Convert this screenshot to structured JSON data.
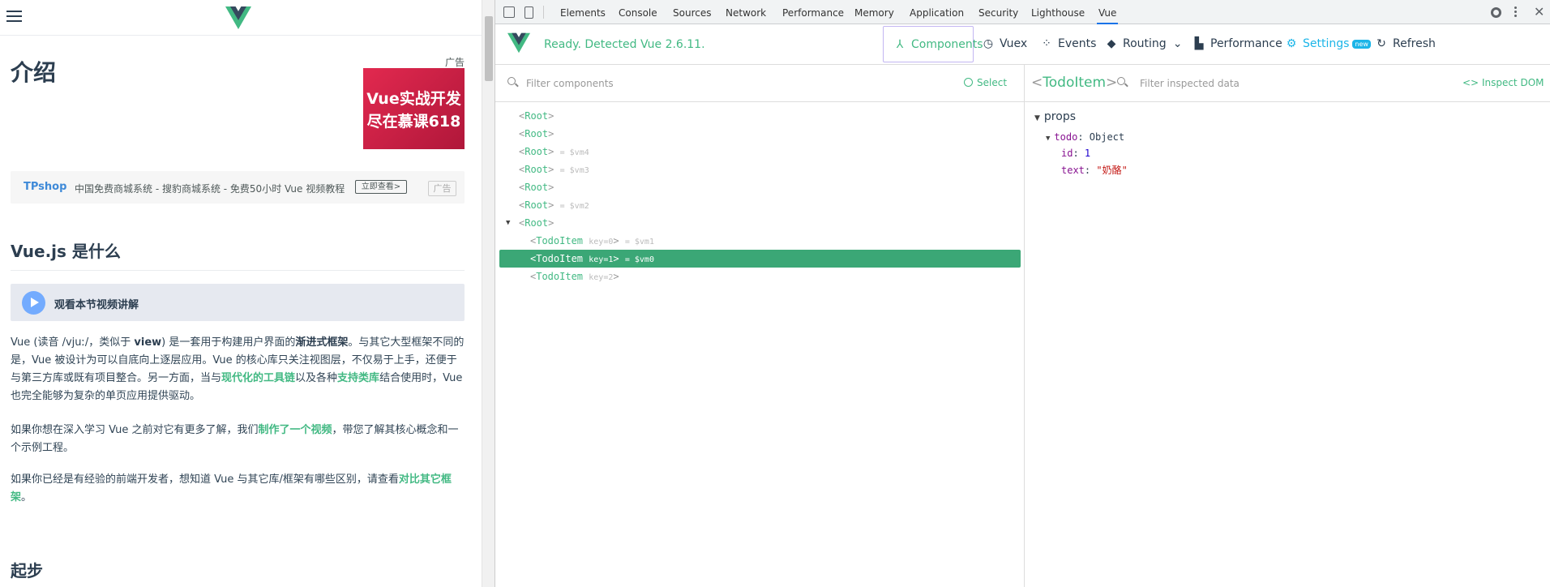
{
  "page": {
    "title": "介绍",
    "ad_label": "广告",
    "ad_lines": [
      "Vue实战开发",
      "尽在慕课618"
    ],
    "tp": {
      "name": "TPshop",
      "text": "中国免费商城系统 - 搜豹商城系统 - 免费50小时 Vue 视频教程",
      "button": "立即查看>",
      "ad": "广告"
    },
    "h2_what": "Vue.js 是什么",
    "video_label": "观看本节视频讲解",
    "p1": {
      "a": "Vue (读音 /vjuː/，类似于 ",
      "b1": "view",
      "c": ") 是一套用于构建用户界面的",
      "b2": "渐进式框架",
      "d": "。与其它大型框架不同的是，Vue 被设计为可以自底向上逐层应用。Vue 的核心库只关注视图层，不仅易于上手，还便于与第三方库或既有项目整合。另一方面，当与",
      "link1": "现代化的工具链",
      "e": "以及各种",
      "link2": "支持类库",
      "f": "结合使用时，Vue 也完全能够为复杂的单页应用提供驱动。"
    },
    "p2": {
      "a": "如果你想在深入学习 Vue 之前对它有更多了解，我们",
      "link": "制作了一个视频",
      "b": "，带您了解其核心概念和一个示例工程。"
    },
    "p3": {
      "a": "如果你已经是有经验的前端开发者，想知道 Vue 与其它库/框架有哪些区别，请查看",
      "link": "对比其它框架",
      "b": "。"
    },
    "h2_start": "起步"
  },
  "devtools": {
    "tabs": [
      "Elements",
      "Console",
      "Sources",
      "Network",
      "Performance",
      "Memory",
      "Application",
      "Security",
      "Lighthouse",
      "Vue"
    ],
    "active_tab": "Vue"
  },
  "vue": {
    "status": "Ready. Detected Vue 2.6.11.",
    "nav": {
      "components": "Components",
      "vuex": "Vuex",
      "events": "Events",
      "routing": "Routing",
      "performance": "Performance",
      "settings": "Settings",
      "settings_badge": "new",
      "refresh": "Refresh"
    },
    "filter_components_placeholder": "Filter components",
    "select_label": "Select",
    "tree": [
      {
        "name": "Root",
        "vm": ""
      },
      {
        "name": "Root",
        "vm": ""
      },
      {
        "name": "Root",
        "vm": "= $vm4"
      },
      {
        "name": "Root",
        "vm": "= $vm3"
      },
      {
        "name": "Root",
        "vm": ""
      },
      {
        "name": "Root",
        "vm": "= $vm2"
      },
      {
        "name": "Root",
        "vm": ""
      },
      {
        "name": "TodoItem",
        "attr": "key=0",
        "vm": "= $vm1"
      },
      {
        "name": "TodoItem",
        "attr": "key=1",
        "vm": "= $vm0"
      },
      {
        "name": "TodoItem",
        "attr": "key=2",
        "vm": ""
      }
    ],
    "inspected": {
      "component": "TodoItem",
      "filter_placeholder": "Filter inspected data",
      "inspect_dom": "Inspect DOM",
      "section": "props",
      "prop_name": "todo",
      "prop_type": "Object",
      "fields": [
        {
          "key": "id",
          "value": "1"
        },
        {
          "key": "text",
          "value": "\"奶酪\""
        }
      ]
    }
  },
  "colors": {
    "vue_green": "#42b983",
    "selected_row": "#3ba776"
  }
}
